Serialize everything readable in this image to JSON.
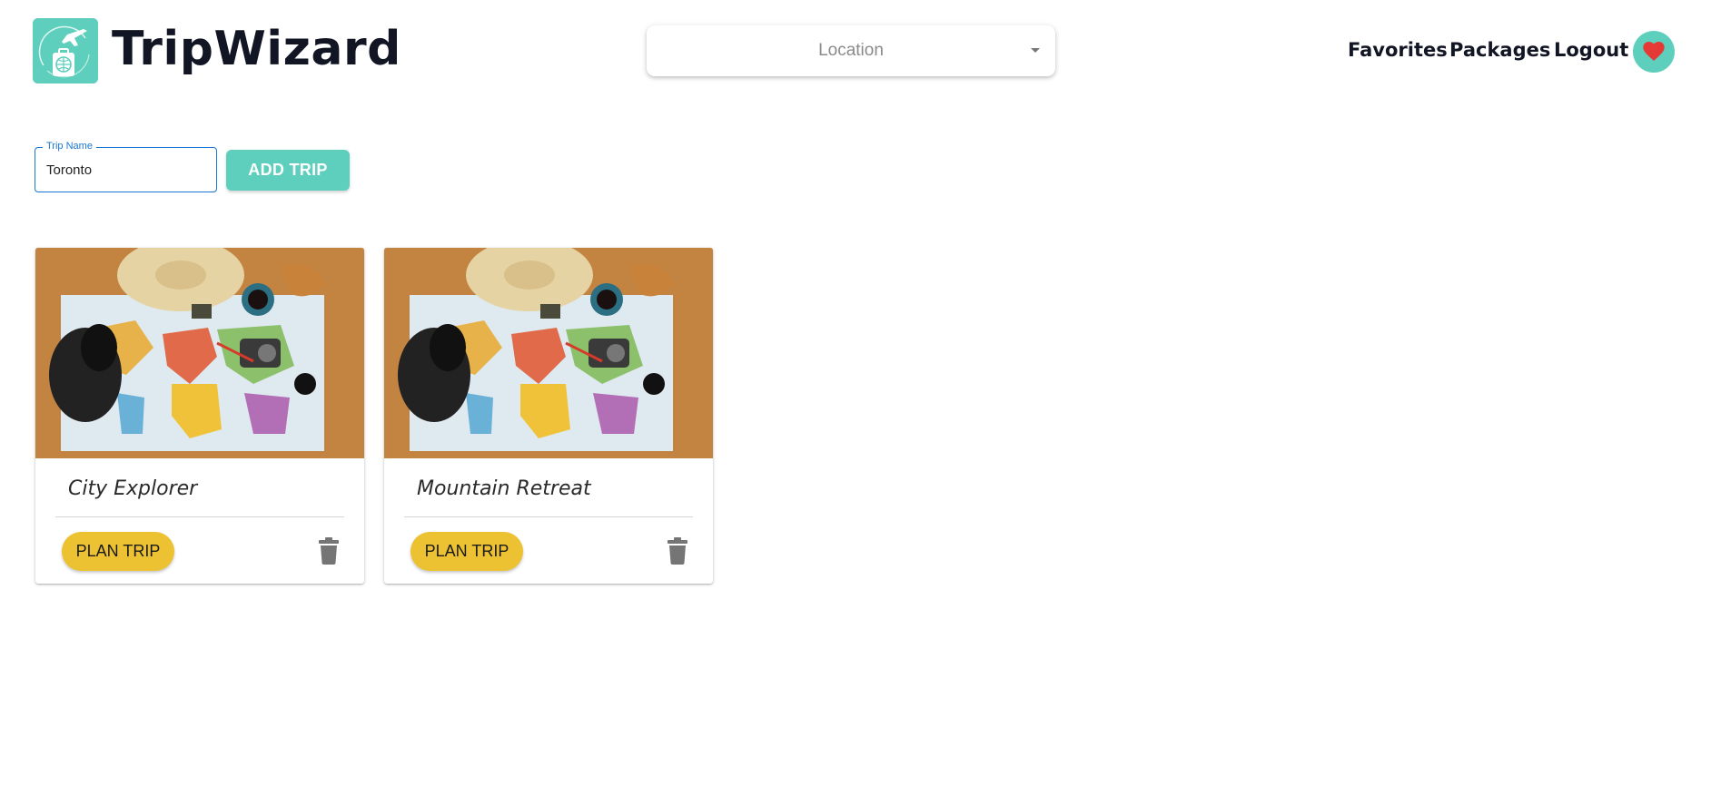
{
  "brand": {
    "name": "TripWizard",
    "logo_icon": "plane-globe-suitcase-icon"
  },
  "location_select": {
    "placeholder": "Location"
  },
  "nav": {
    "favorites": "Favorites",
    "packages": "Packages",
    "logout": "Logout",
    "favorites_icon": "heart-icon"
  },
  "add_trip": {
    "field_label": "Trip Name",
    "field_value": "Toronto",
    "button_label": "ADD TRIP"
  },
  "trips": [
    {
      "title": "City Explorer",
      "plan_label": "PLAN TRIP",
      "delete_icon": "trash-icon"
    },
    {
      "title": "Mountain Retreat",
      "plan_label": "PLAN TRIP",
      "delete_icon": "trash-icon"
    }
  ],
  "colors": {
    "accent": "#5ecfbc",
    "plan_button": "#ecc232",
    "focus_blue": "#1976d2",
    "heart": "#e53935"
  }
}
